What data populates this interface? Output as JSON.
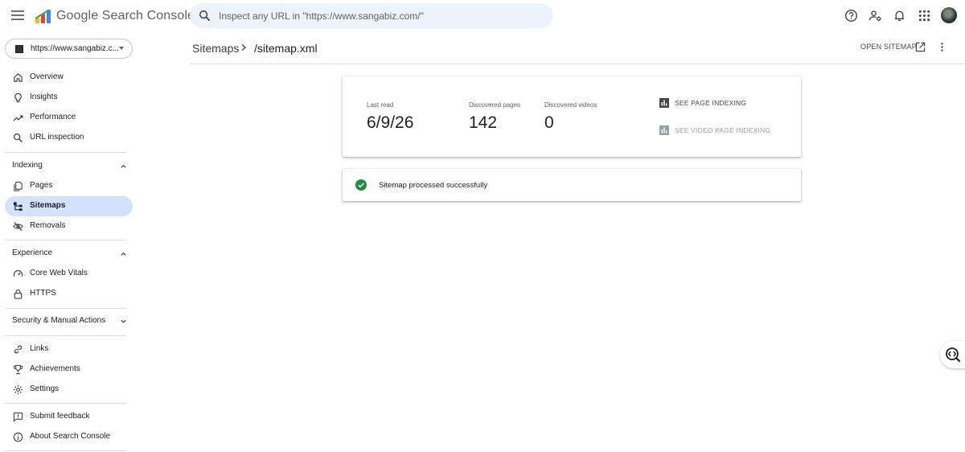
{
  "app": {
    "brand": "Google Search Console",
    "search_placeholder": "Inspect any URL in \"https://www.sangabiz.com/\""
  },
  "property": {
    "label": "https://www.sangabiz.c..."
  },
  "sidebar": {
    "top": [
      {
        "label": "Overview",
        "icon": "home-icon"
      },
      {
        "label": "Insights",
        "icon": "lightbulb-icon"
      },
      {
        "label": "Performance",
        "icon": "trending-up-icon"
      },
      {
        "label": "URL inspection",
        "icon": "search-icon"
      }
    ],
    "sections": [
      {
        "title": "Indexing",
        "expanded": true,
        "items": [
          {
            "label": "Pages",
            "icon": "pages-icon"
          },
          {
            "label": "Sitemaps",
            "icon": "sitemap-icon",
            "active": true
          },
          {
            "label": "Removals",
            "icon": "visibility-off-icon"
          }
        ]
      },
      {
        "title": "Experience",
        "expanded": true,
        "items": [
          {
            "label": "Core Web Vitals",
            "icon": "speed-icon"
          },
          {
            "label": "HTTPS",
            "icon": "lock-icon"
          }
        ]
      },
      {
        "title": "Security & Manual Actions",
        "expanded": false,
        "items": []
      }
    ],
    "bottom1": [
      {
        "label": "Links",
        "icon": "link-icon"
      },
      {
        "label": "Achievements",
        "icon": "trophy-icon"
      },
      {
        "label": "Settings",
        "icon": "gear-icon"
      }
    ],
    "bottom2": [
      {
        "label": "Submit feedback",
        "icon": "feedback-icon"
      },
      {
        "label": "About Search Console",
        "icon": "info-icon"
      }
    ]
  },
  "header": {
    "breadcrumb_parent": "Sitemaps",
    "breadcrumb_current": "/sitemap.xml",
    "open_sitemap": "OPEN SITEMAP"
  },
  "summary": {
    "last_read_label": "Last read",
    "last_read_value": "6/9/26",
    "discovered_pages_label": "Discovered pages",
    "discovered_pages_value": "142",
    "discovered_videos_label": "Discovered videos",
    "discovered_videos_value": "0",
    "see_page_indexing": "SEE PAGE INDEXING",
    "see_video_page_indexing": "SEE VIDEO PAGE INDEXING"
  },
  "status": {
    "text": "Sitemap processed successfully"
  },
  "colors": {
    "active_nav": "#d3e3fd",
    "search_bg": "#eef2fa",
    "success": "#1e8e3e",
    "disabled": "#9aa0a6"
  }
}
